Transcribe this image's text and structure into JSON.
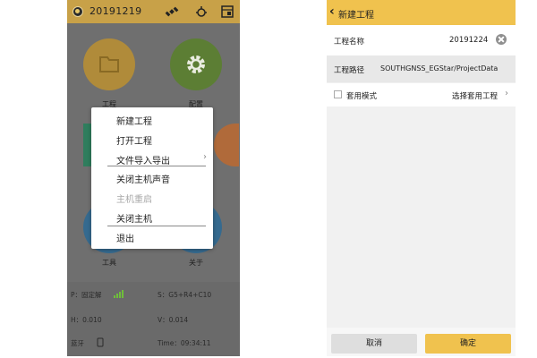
{
  "left_screen": {
    "header": {
      "title": "20191219"
    },
    "grid": {
      "items": [
        {
          "label": "工程",
          "color": "#c9a044",
          "icon": "folder-icon"
        },
        {
          "label": "配置",
          "color": "#6f9a3d",
          "icon": "gear-icon"
        },
        {
          "label": "工具",
          "color": "#3d7aa9",
          "icon": "tools-icon"
        },
        {
          "label": "关于",
          "color": "#3d7aa9",
          "icon": "info-icon"
        }
      ]
    },
    "menu": {
      "items": [
        {
          "label": "新建工程",
          "enabled": true
        },
        {
          "label": "打开工程",
          "enabled": true
        },
        {
          "label": "文件导入导出",
          "enabled": true,
          "submenu": true
        },
        {
          "label": "关闭主机声音",
          "enabled": true
        },
        {
          "label": "主机重启",
          "enabled": false
        },
        {
          "label": "关闭主机",
          "enabled": true
        },
        {
          "label": "退出",
          "enabled": true
        }
      ]
    },
    "status": {
      "p_label": "P：固定解",
      "s_label": "S：G5+R4+C10",
      "h_label": "H：0.010",
      "v_label": "V：0.014",
      "bt_label": "蓝牙",
      "time_label": "Time：09:34:11"
    }
  },
  "right_screen": {
    "header": {
      "title": "新建工程"
    },
    "fields": {
      "name_label": "工程名称",
      "name_value": "20191224",
      "path_label": "工程路径",
      "path_value": "SOUTHGNSS_EGStar/ProjectData",
      "template_label": "套用模式",
      "template_link": "选择套用工程"
    },
    "buttons": {
      "cancel": "取消",
      "confirm": "确定"
    }
  },
  "colors": {
    "left_header": "#c8a148",
    "right_header": "#f0c24e",
    "confirm_button": "#f0c24e",
    "cancel_button": "#dedede"
  }
}
